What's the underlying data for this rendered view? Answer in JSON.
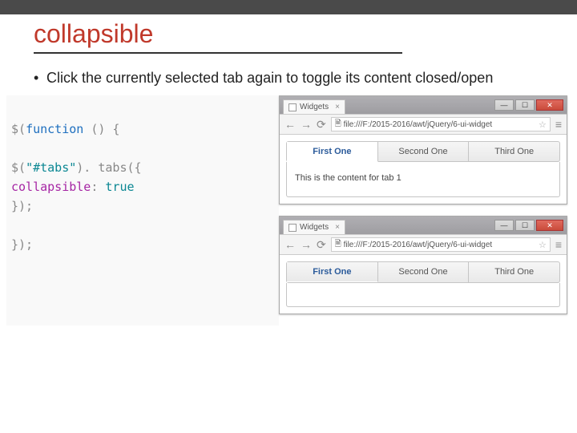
{
  "slide": {
    "title": "collapsible",
    "bullet": "Click the currently selected tab again to toggle its content closed/open"
  },
  "code": {
    "line1a": "$(",
    "line1b": "function ",
    "line1c": "() {",
    "line2a": "    $(",
    "line2b": "\"#tabs\"",
    "line2c": ").",
    "line2d": " tabs",
    "line2e": "({",
    "line3a": "        ",
    "line3b": "collapsible",
    "line3c": ": ",
    "line3d": "true",
    "line4": "    });",
    "line5": "});"
  },
  "browser": {
    "tab_title": "Widgets",
    "url": "file:///F:/2015-2016/awt/jQuery/6-ui-widget",
    "url2": "file:///F:/2015-2016/awt/jQuery/6-ui-widget"
  },
  "tabs": {
    "items": [
      "First One",
      "Second One",
      "Third One"
    ],
    "content1": "This is the content for tab 1"
  }
}
